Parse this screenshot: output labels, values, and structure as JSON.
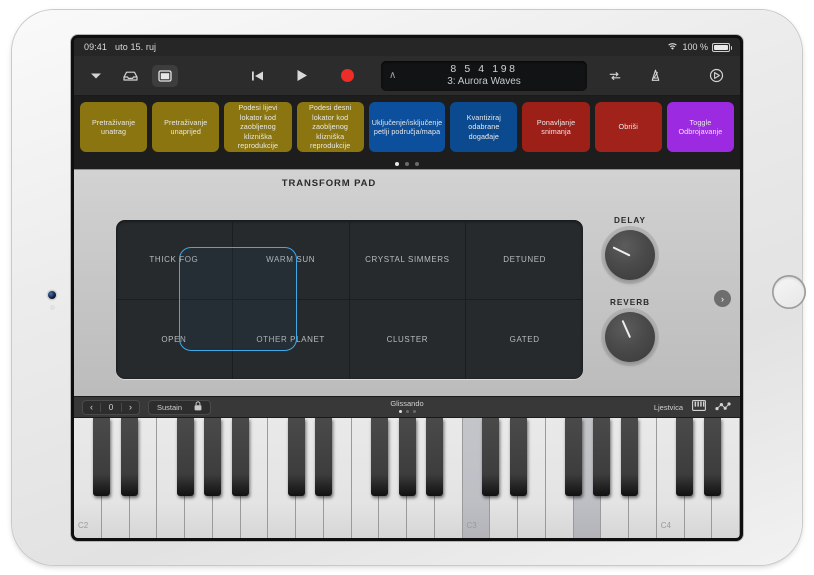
{
  "status_bar": {
    "time": "09:41",
    "date": "uto 15. ruj",
    "wifi_icon": "wifi-icon",
    "battery_percent": "100 %"
  },
  "control_bar": {
    "chevron_down_icon": "chevron-down-icon",
    "loops_browser_icon": "loop-browser-icon",
    "view_toggle_icon": "view-toggle-icon",
    "rewind_icon": "rewind-to-start-icon",
    "play_icon": "play-icon",
    "record_icon": "record-icon",
    "lcd": {
      "caret": "∧",
      "position": "8  5  4  198",
      "track": "3: Aurora Waves"
    },
    "cycle_icon": "cycle-icon",
    "metronome_icon": "metronome-icon",
    "settings_icon": "settings-icon"
  },
  "command_strip": {
    "buttons": [
      {
        "label": "Pretraživanje unatrag",
        "color": "#8a7510"
      },
      {
        "label": "Pretraživanje unaprijed",
        "color": "#8a7510"
      },
      {
        "label": "Podesi lijevi lokator kod zaobljenog klizniška reprodukcije",
        "color": "#8a7510"
      },
      {
        "label": "Podesi desni lokator kod zaobljenog klizniška reprodukcije",
        "color": "#8a7510"
      },
      {
        "label": "Uključenje/isključenje petlji područja/mapa",
        "color": "#0c4f9c"
      },
      {
        "label": "Kvantiziraj odabrane događaje",
        "color": "#0c4a8f"
      },
      {
        "label": "Ponavljanje snimanja",
        "color": "#9c2018"
      },
      {
        "label": "Obriši",
        "color": "#a0221a"
      },
      {
        "label": "Toggle Odbrojavanje",
        "color": "#9b2ae0"
      }
    ],
    "page_dots": {
      "count": 3,
      "active_index": 0
    }
  },
  "plugin_panel": {
    "title": "TRANSFORM PAD",
    "pad_cells": [
      "THICK FOG",
      "WARM SUN",
      "CRYSTAL SIMMERS",
      "DETUNED",
      "OPEN",
      "OTHER PLANET",
      "CLUSTER",
      "GATED"
    ],
    "selection_highlight_color": "#3da9e8",
    "knobs": [
      {
        "label": "DELAY",
        "angle_deg": 206
      },
      {
        "label": "REVERB",
        "angle_deg": 246
      }
    ],
    "next_page_icon": "chevron-right-icon"
  },
  "keyboard_toolbar": {
    "octave_prev_icon": "chevron-left-icon",
    "octave_value": "0",
    "octave_next_icon": "chevron-right-icon",
    "sustain_label": "Sustain",
    "lock_icon": "lock-icon",
    "glissando_label": "Glissando",
    "glissando_dots": {
      "count": 3,
      "active_index": 0
    },
    "scale_label": "Ljestvica",
    "keyboard_layout_icon": "keyboard-icon",
    "arpeggiator_icon": "arpeggiator-icon"
  },
  "keyboard": {
    "octave_labels": [
      "C2",
      "C3",
      "C4"
    ],
    "white_key_count": 24,
    "held_white_keys": [
      14,
      18
    ],
    "octave_label_keys": [
      0,
      14,
      21
    ]
  }
}
